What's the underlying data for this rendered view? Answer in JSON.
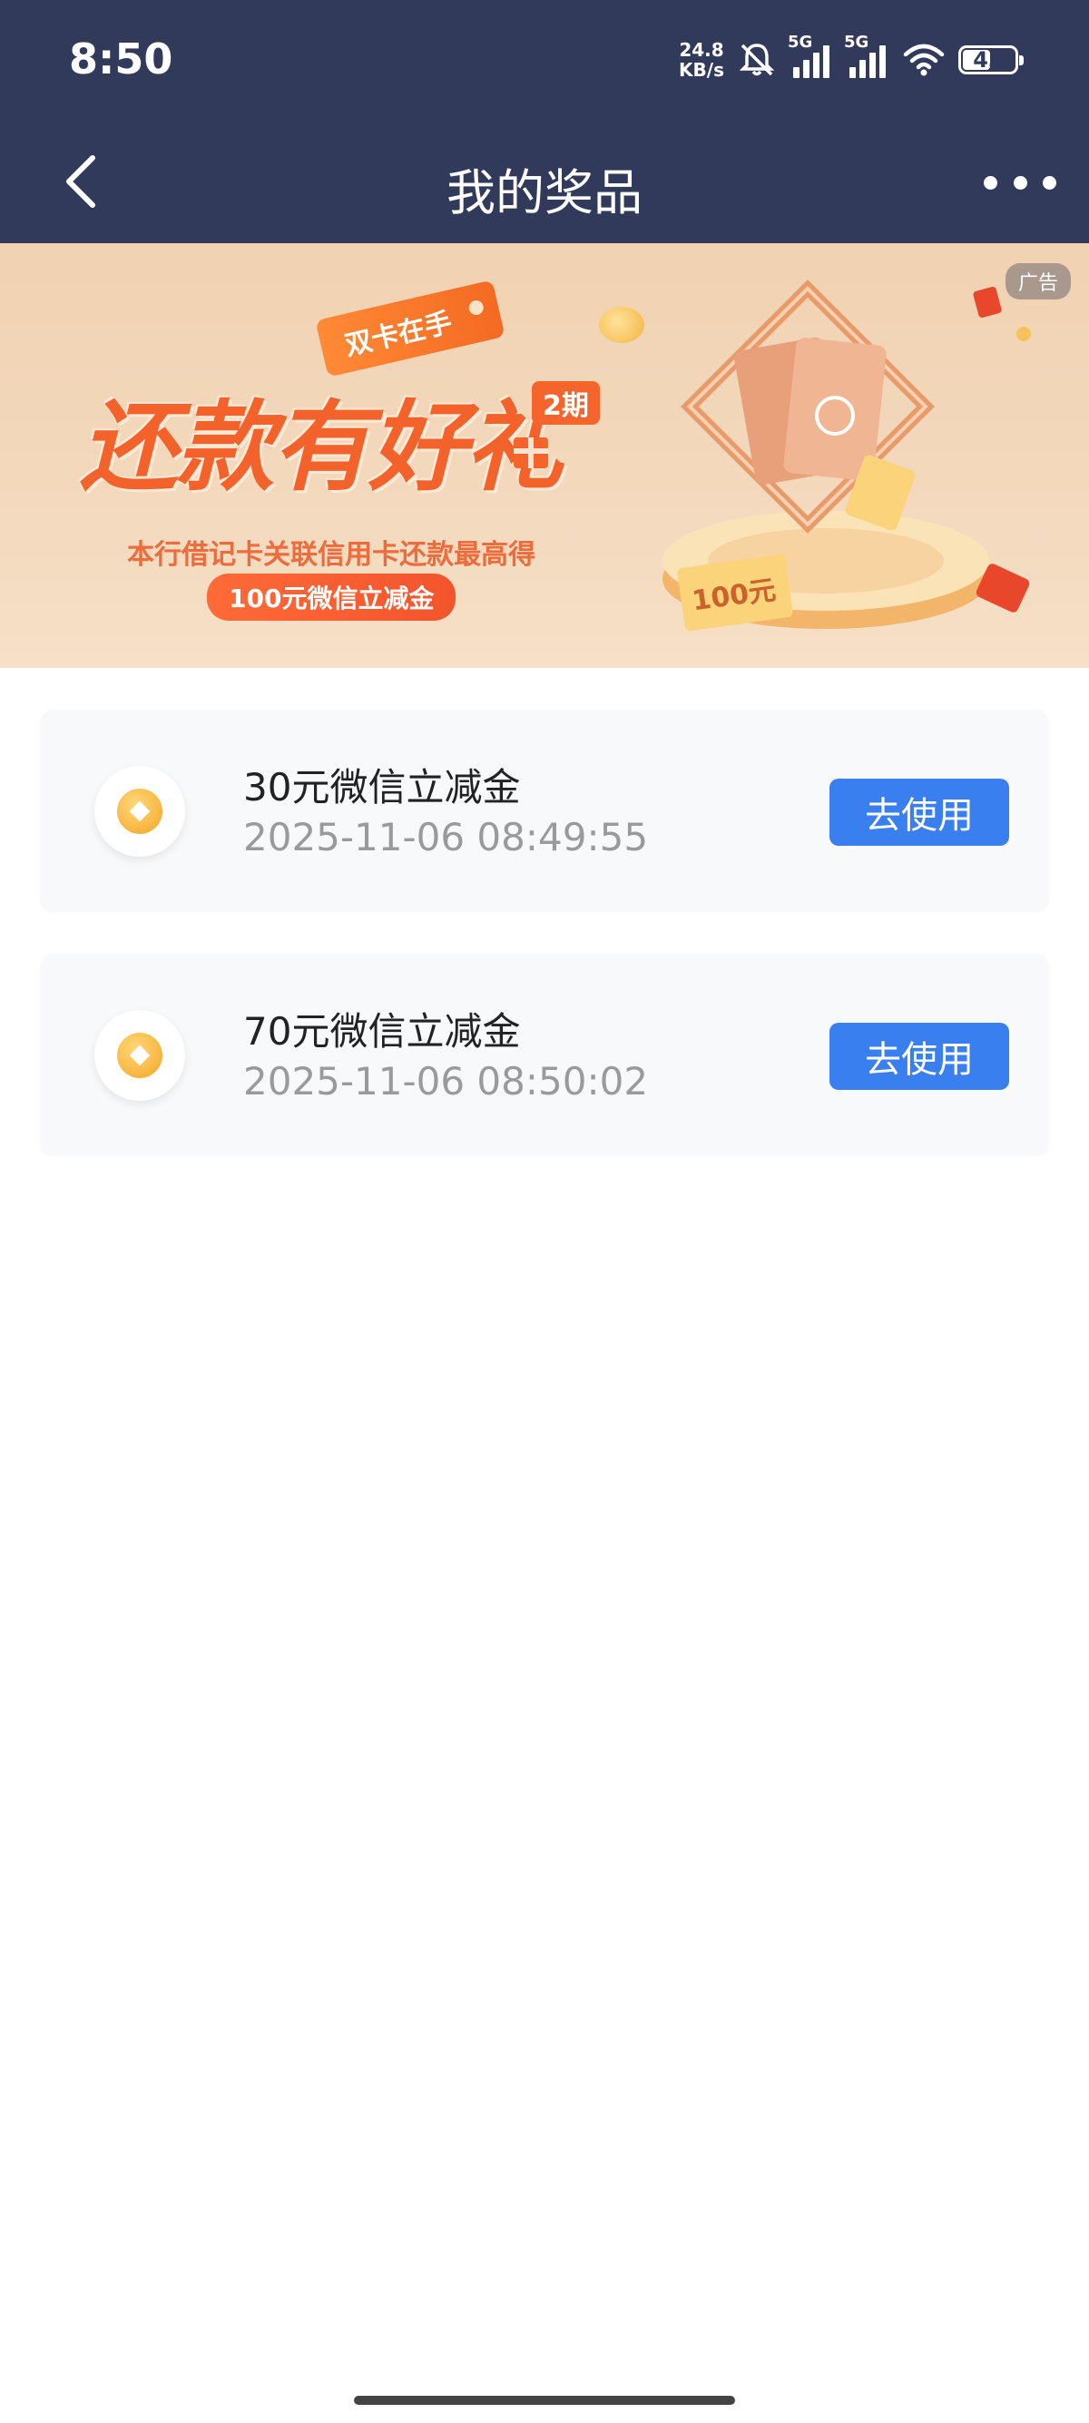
{
  "status_bar": {
    "time": "8:50",
    "net_speed_value": "24.8",
    "net_speed_unit": "KB/s",
    "signal1_label": "5G",
    "signal2_label": "5G",
    "battery": "43",
    "icons": [
      "mute-bell-icon",
      "signal-icon",
      "signal-icon",
      "wifi-icon",
      "battery-icon"
    ]
  },
  "header": {
    "title": "我的奖品",
    "back_icon": "chevron-left-icon",
    "more_icon": "more-dots-icon"
  },
  "banner": {
    "ad_label": "广告",
    "tag": "双卡在手",
    "headline": "还款有好礼",
    "period": "2期",
    "subtitle": "本行借记卡关联信用卡还款最高得",
    "pill": "100元微信立减金",
    "ticket_text": "100元"
  },
  "prizes": [
    {
      "name": "30元微信立减金",
      "date": "2025-11-06 08:49:55",
      "action": "去使用"
    },
    {
      "name": "70元微信立减金",
      "date": "2025-11-06 08:50:02",
      "action": "去使用"
    }
  ],
  "colors": {
    "header_bg": "#323a5c",
    "button": "#3a7ff0",
    "banner_accent": "#f3622b"
  }
}
